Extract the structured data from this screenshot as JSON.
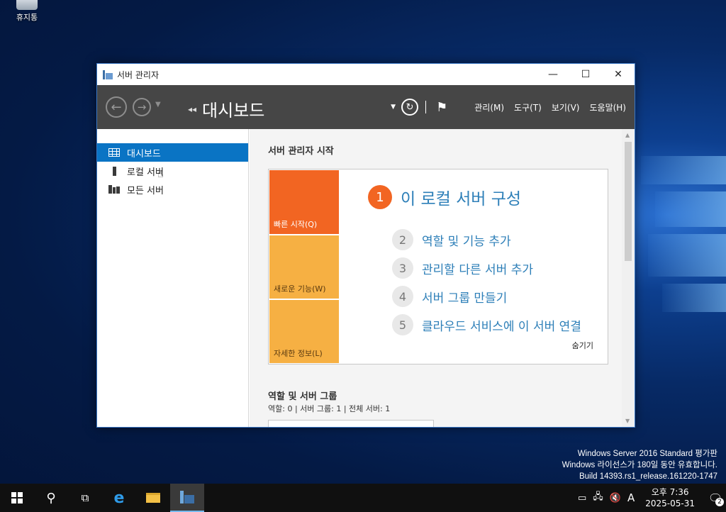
{
  "desktop": {
    "recycle_bin_label": "휴지통",
    "watermark": {
      "line1": "Windows Server 2016 Standard 평가판",
      "line2": "Windows 라이선스가 180일 동안 유효합니다.",
      "line3": "Build 14393.rs1_release.161220-1747"
    }
  },
  "window": {
    "title": "서버 관리자",
    "controls": {
      "minimize": "—",
      "maximize": "☐",
      "close": "✕"
    }
  },
  "toolbar": {
    "breadcrumb": "대시보드",
    "menus": [
      "관리(M)",
      "도구(T)",
      "보기(V)",
      "도움말(H)"
    ]
  },
  "sidebar": {
    "items": [
      {
        "label": "대시보드",
        "icon": "dashboard-grid-icon",
        "active": true
      },
      {
        "label": "로컬 서버",
        "icon": "server-icon",
        "active": false
      },
      {
        "label": "모든 서버",
        "icon": "servers-icon",
        "active": false
      }
    ]
  },
  "main": {
    "section_title": "서버 관리자 시작",
    "tiles": [
      "빠른 시작(Q)",
      "새로운 기능(W)",
      "자세한 정보(L)"
    ],
    "steps": [
      {
        "num": "1",
        "label": "이 로컬 서버 구성"
      },
      {
        "num": "2",
        "label": "역할 및 기능 추가"
      },
      {
        "num": "3",
        "label": "관리할 다른 서버 추가"
      },
      {
        "num": "4",
        "label": "서버 그룹 만들기"
      },
      {
        "num": "5",
        "label": "클라우드 서비스에 이 서버 연결"
      }
    ],
    "hide_label": "숨기기",
    "roles_title": "역할 및 서버 그룹",
    "roles_stats": "역할: 0   |   서버 그룹: 1   |   전체 서버: 1"
  },
  "taskbar": {
    "tray_lang": "A",
    "time": "오후 7:36",
    "date": "2025-05-31",
    "notification_count": "2"
  },
  "colors": {
    "accent": "#0a74c4",
    "quick_start": "#f26522",
    "tile_secondary": "#f6b043",
    "link": "#2d7fb8",
    "toolbar_bg": "#464646"
  }
}
